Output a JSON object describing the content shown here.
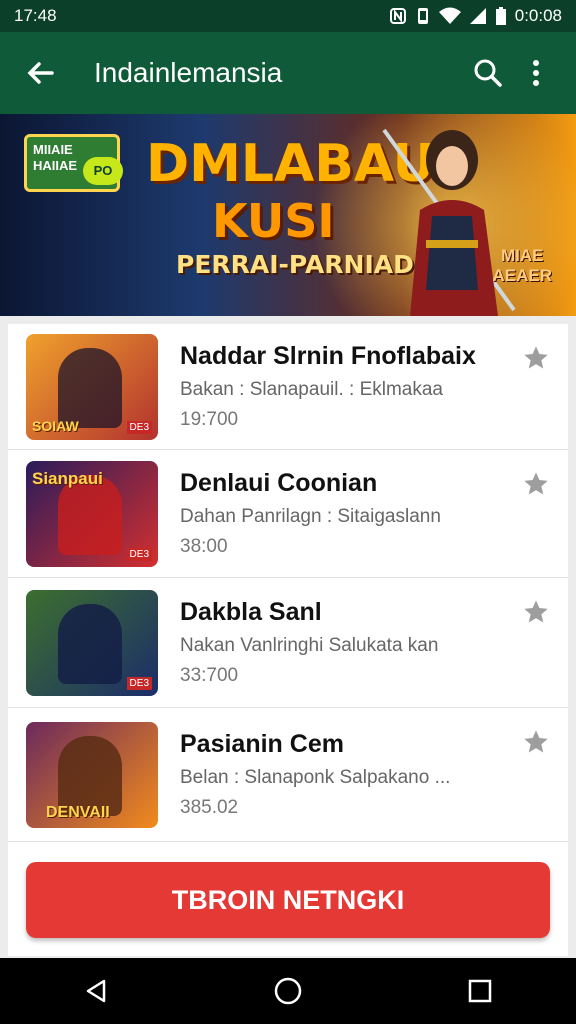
{
  "status_bar": {
    "time": "17:48",
    "right_text": "0:0:08",
    "icons": [
      "nfc-icon",
      "vibrate-icon",
      "wifi-icon",
      "signal-icon",
      "battery-icon"
    ]
  },
  "app_bar": {
    "title": "Indainlemansia",
    "icons": [
      "back-arrow-icon",
      "search-icon",
      "more-vert-icon"
    ]
  },
  "banner": {
    "logo_text": "MIIAIE HAIIAE",
    "logo_badge": "PO",
    "headline_1": "DMLABAUI",
    "headline_2": "KUSI",
    "subhead": "PERRAI-PARNIAD",
    "corner_text_1": "MIAE",
    "corner_text_2": "AEAER"
  },
  "items": [
    {
      "name": "Naddar Slrnin Fnoflabaix",
      "desc": "Bakan : Slanapauil. : Eklmakaa",
      "value": "19:700",
      "thumb_caption": "SOIAW",
      "thumb_tag": "DE3",
      "thumb_colors": [
        "#f0a12d",
        "#b2322e"
      ]
    },
    {
      "name": "Denlaui Coonian",
      "desc": "Dahan Panrilagn : Sitaigaslann",
      "value": "38:00",
      "thumb_caption": "Sianpaui",
      "thumb_tag": "DE3",
      "thumb_colors": [
        "#2a1c5b",
        "#d32f2f"
      ]
    },
    {
      "name": "Dakbla Sanl",
      "desc": "Nakan Vanlringhi Salukata kan",
      "value": "33:700",
      "thumb_caption": "",
      "thumb_tag": "DE3",
      "thumb_colors": [
        "#3c6f2e",
        "#1c2d6a"
      ]
    },
    {
      "name": "Pasianin Cem",
      "desc": "Belan : Slanaponk Salpakano ...",
      "value": "385.02",
      "thumb_caption": "DENVAII",
      "thumb_tag": "",
      "thumb_colors": [
        "#6c2a5c",
        "#f28b1d"
      ]
    }
  ],
  "cta": {
    "label": "TBROIN NETNGKI"
  },
  "colors": {
    "app_bar": "#0f5a38",
    "status_bar": "#0b3f2a",
    "cta": "#e53935",
    "star": "#9e9e9e"
  },
  "nav_bar": {
    "icons": [
      "back-triangle-icon",
      "home-circle-icon",
      "recents-square-icon"
    ]
  }
}
